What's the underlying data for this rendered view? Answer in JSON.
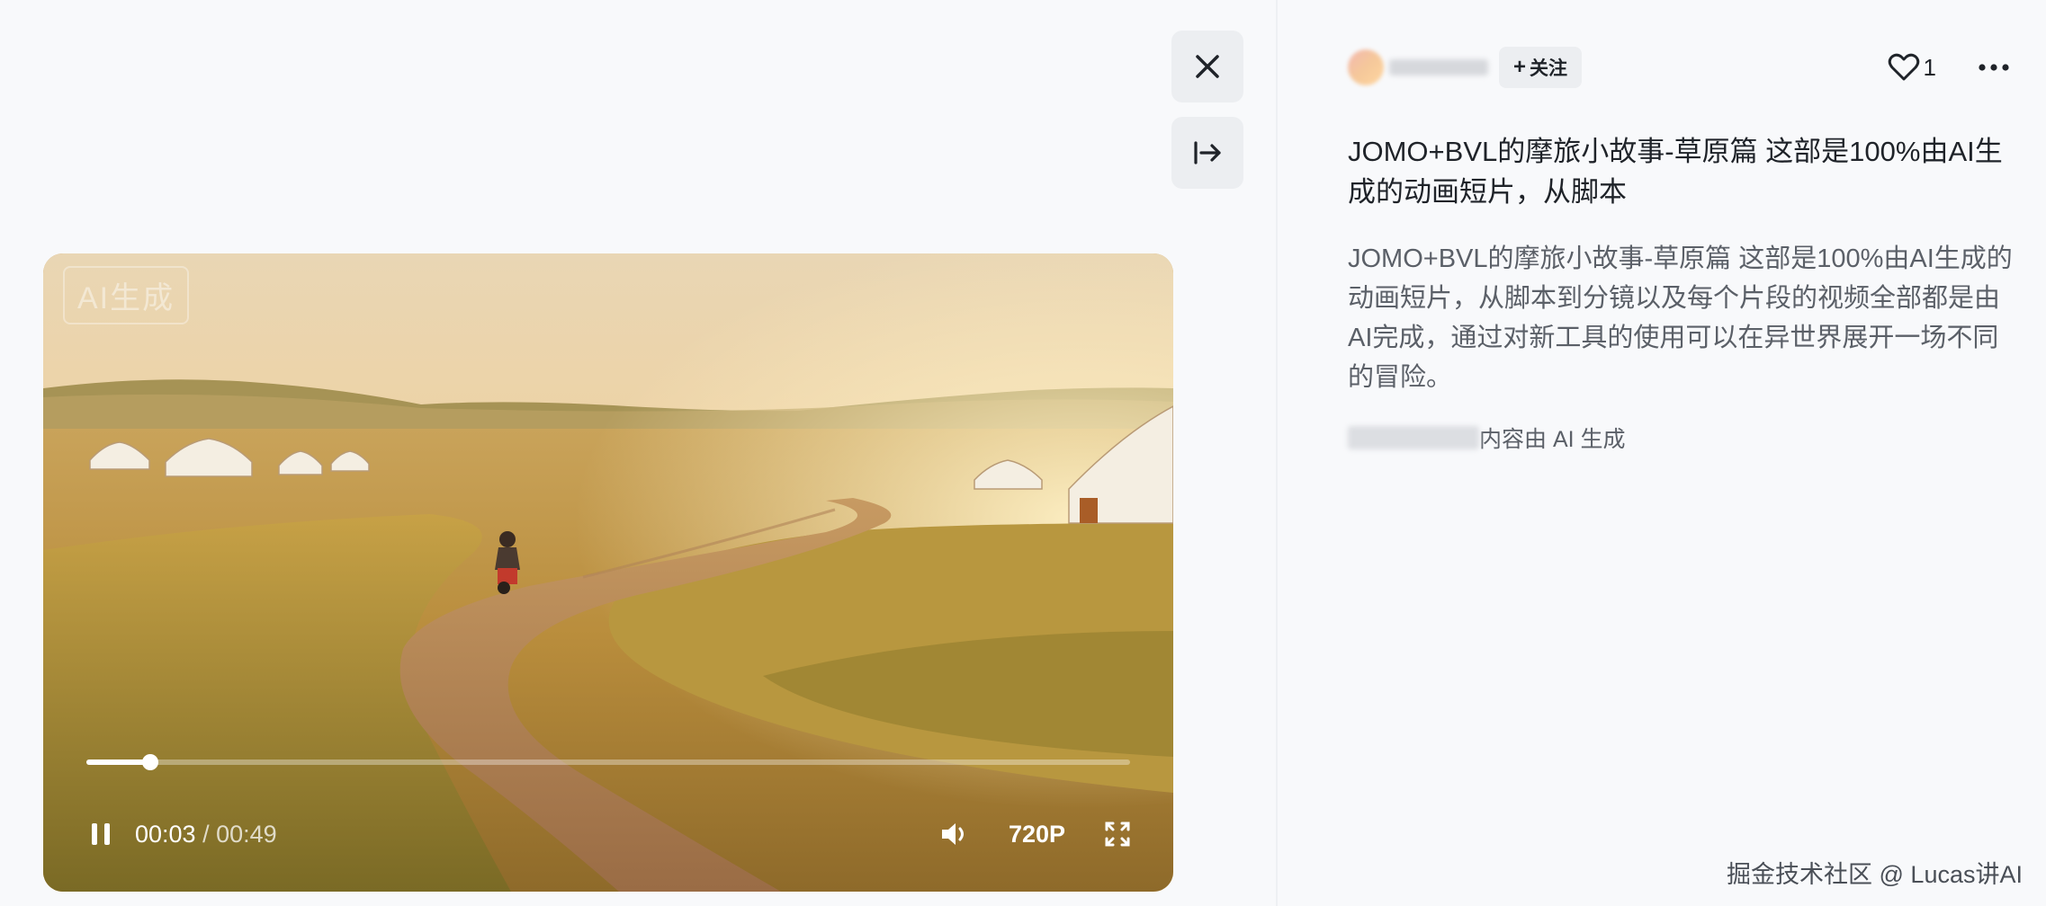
{
  "player": {
    "watermark": "AI生成",
    "progress": 0.061,
    "current_time": "00:03",
    "separator": " / ",
    "duration": "00:49",
    "quality": "720P"
  },
  "author": {
    "follow_label": "关注",
    "follow_icon": "plus-icon",
    "like_icon": "heart-icon",
    "like_count": "1",
    "more_icon": "more-horizontal-icon"
  },
  "side_buttons": {
    "close_icon": "close-icon",
    "collapse_icon": "arrow-right-bar-icon"
  },
  "post": {
    "title": "JOMO+BVL的摩旅小故事-草原篇 这部是100%由AI生成的动画短片，从脚本",
    "description": "JOMO+BVL的摩旅小故事-草原篇 这部是100%由AI生成的动画短片，从脚本到分镜以及每个片段的视频全部都是由AI完成，通过对新工具的使用可以在异世界展开一场不同的冒险。",
    "ai_notice": "内容由 AI 生成"
  },
  "footer": {
    "watermark": "掘金技术社区 @ Lucas讲AI"
  },
  "colors": {
    "page_bg": "#f8f9fb",
    "button_bg": "#eceef1",
    "text_primary": "#1f2329",
    "text_secondary": "#5b6068"
  }
}
